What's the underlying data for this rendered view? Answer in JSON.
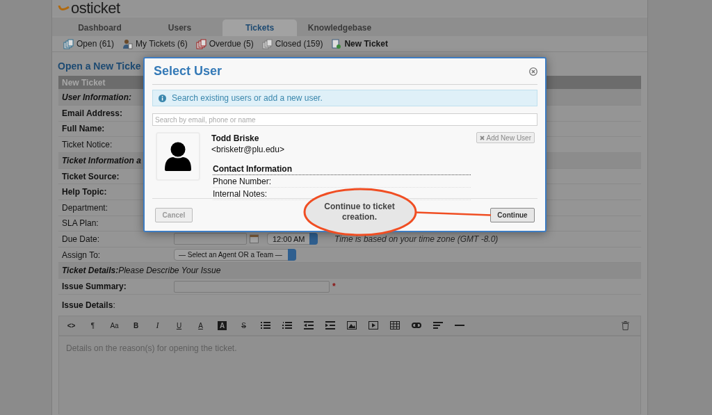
{
  "logo": {
    "text": "osticket"
  },
  "tabs": [
    {
      "label": "Dashboard",
      "selected": false
    },
    {
      "label": "Users",
      "selected": false
    },
    {
      "label": "Tickets",
      "selected": true
    },
    {
      "label": "Knowledgebase",
      "selected": false
    }
  ],
  "subnav": [
    {
      "kind": "open",
      "label": "Open (61)",
      "bold": false
    },
    {
      "kind": "mine",
      "label": "My Tickets (6)",
      "bold": false
    },
    {
      "kind": "overdue",
      "label": "Overdue (5)",
      "bold": false
    },
    {
      "kind": "closed",
      "label": "Closed (159)",
      "bold": false
    },
    {
      "kind": "new",
      "label": "New Ticket",
      "bold": true
    }
  ],
  "heading": "Open a New Ticke",
  "form_rows": [
    {
      "kind": "header",
      "label": "New Ticket"
    },
    {
      "kind": "section",
      "label": "User Information:"
    },
    {
      "kind": "field",
      "label": "Email Address:",
      "bold": true
    },
    {
      "kind": "field",
      "label": "Full Name:",
      "bold": true
    },
    {
      "kind": "field",
      "label": "Ticket Notice:",
      "bold": false
    },
    {
      "kind": "section",
      "label": "Ticket Information a"
    },
    {
      "kind": "field",
      "label": "Ticket Source:",
      "bold": true
    },
    {
      "kind": "field",
      "label": "Help Topic:",
      "bold": true
    },
    {
      "kind": "field",
      "label": "Department:",
      "bold": false
    },
    {
      "kind": "field",
      "label": "SLA Plan:",
      "bold": false
    },
    {
      "kind": "field",
      "label": "Due Date:",
      "bold": false,
      "value": {
        "kind": "datetime",
        "time": "12:00 AM",
        "note": "Time is based on your time zone (GMT -8.0)"
      }
    },
    {
      "kind": "field",
      "label": "Assign To:",
      "bold": false,
      "value": {
        "kind": "select",
        "text": "— Select an Agent OR a Team —"
      }
    },
    {
      "kind": "section",
      "label": "Ticket Details:",
      "sublabel": "Please Describe Your Issue"
    },
    {
      "kind": "field",
      "label": "Issue Summary:",
      "bold": true,
      "value": {
        "kind": "input",
        "required_mark": "*"
      }
    }
  ],
  "issue_details": {
    "label": "**Issue Details**:",
    "placeholder": "Details on the reason(s) for opening the ticket.",
    "toolbar_glyphs": [
      {
        "kind": "code",
        "label": "<>"
      },
      {
        "kind": "plain",
        "label": "¶"
      },
      {
        "kind": "plain",
        "label": "Aa"
      },
      {
        "kind": "bold",
        "label": "B"
      },
      {
        "kind": "italic",
        "label": "I"
      },
      {
        "kind": "underline",
        "label": "U"
      },
      {
        "kind": "underline",
        "label": "A"
      },
      {
        "kind": "inverted",
        "label": "A"
      },
      {
        "kind": "strike",
        "label": "S"
      }
    ]
  },
  "dialog": {
    "title": "Select User",
    "info": "Search existing users or add a new user.",
    "search_placeholder": "Search by email, phone or name",
    "user": {
      "name": "Todd Briske",
      "email": "<brisketr@plu.edu>"
    },
    "add_button": "Add New User",
    "contact_title": "Contact Information",
    "contact_rows": [
      "Phone Number:",
      "Internal Notes:"
    ],
    "buttons": [
      {
        "kind": "cancel",
        "label": "Cancel"
      },
      {
        "kind": "continue",
        "label": "Continue"
      }
    ]
  },
  "callout": {
    "text": "Continue to ticket creation."
  }
}
